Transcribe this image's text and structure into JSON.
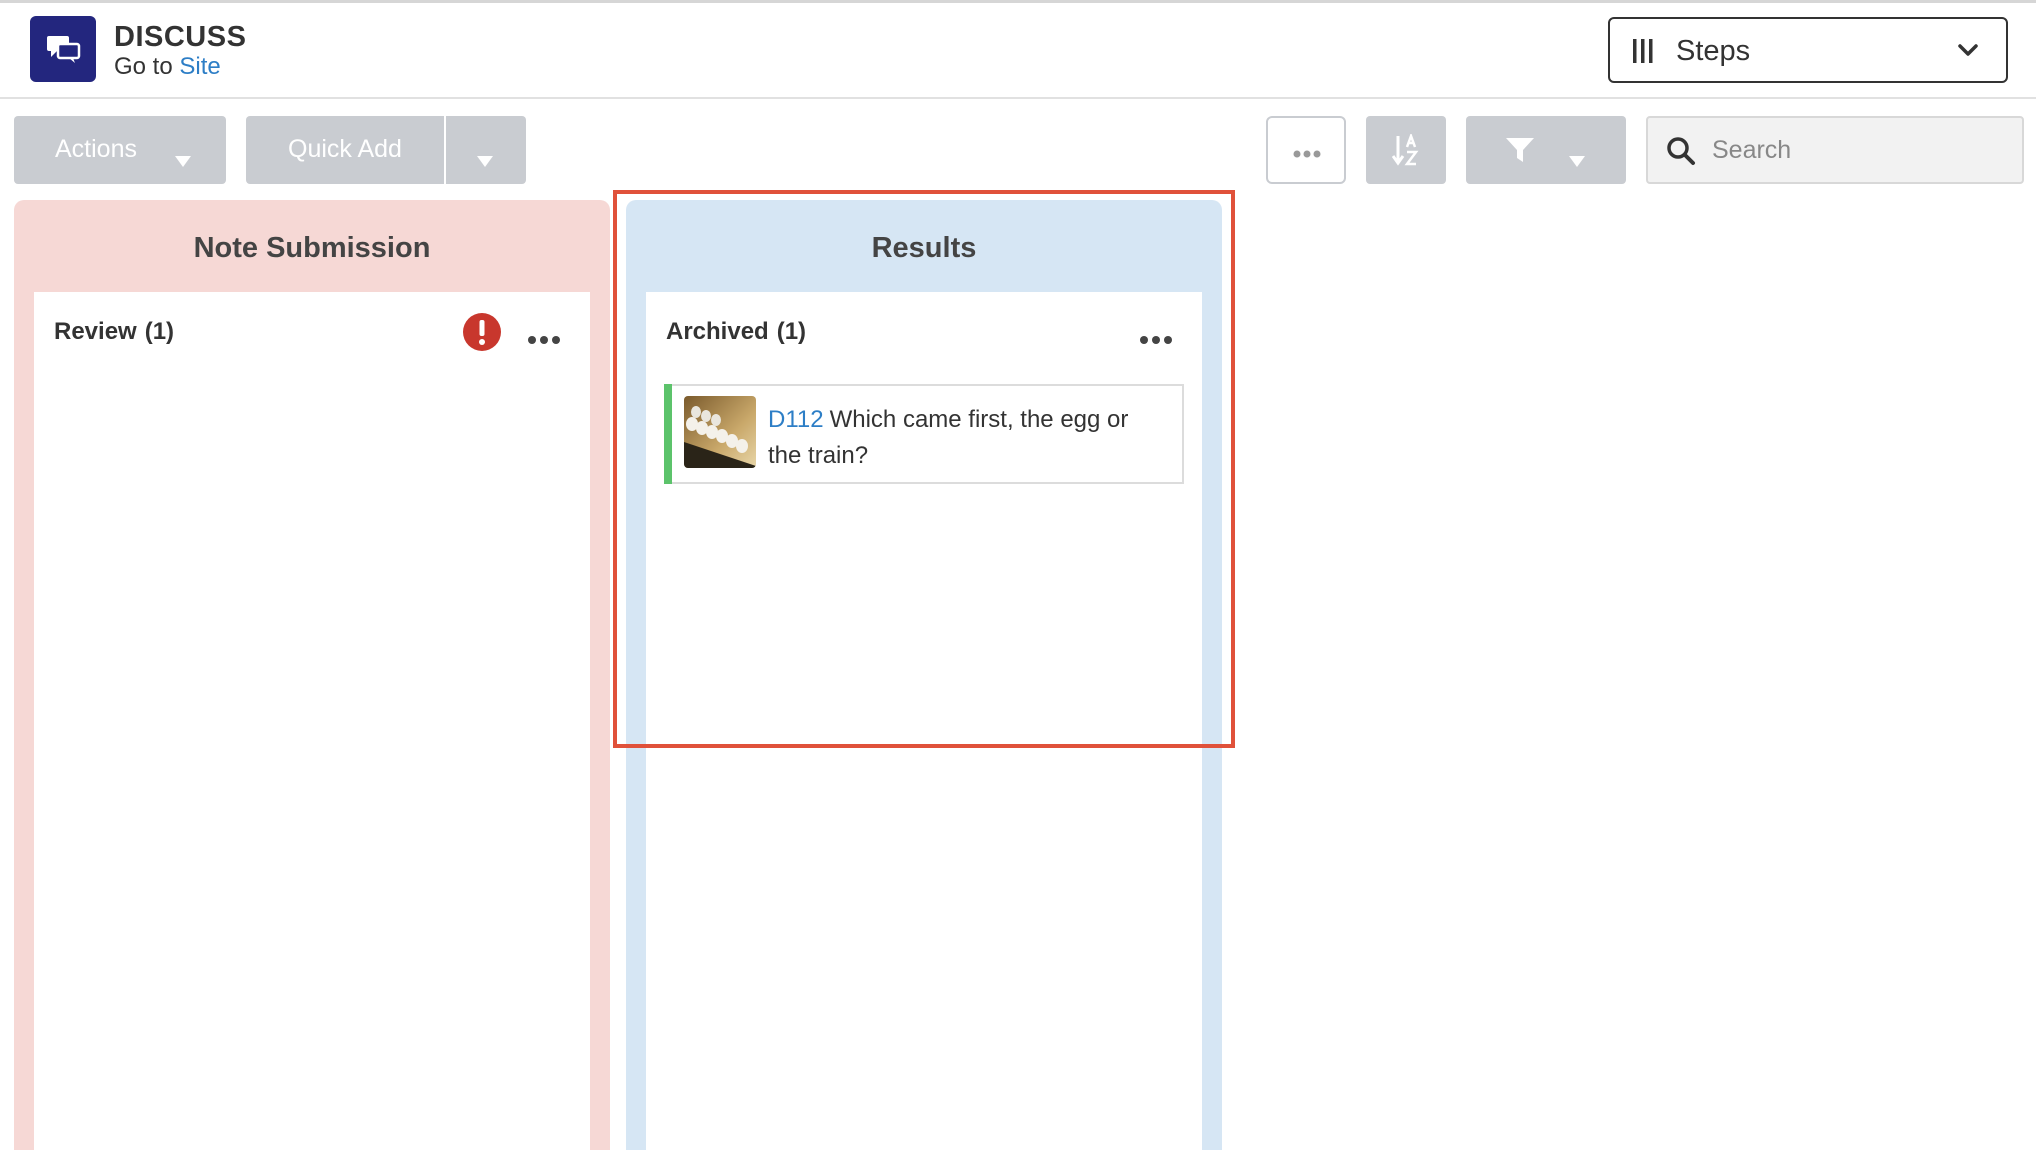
{
  "header": {
    "app_title": "DISCUSS",
    "goto_prefix": "Go to",
    "goto_link": "Site",
    "view_select": {
      "label": "Steps",
      "icon": "columns-icon"
    }
  },
  "toolbar": {
    "actions_label": "Actions",
    "quick_add_label": "Quick Add",
    "search_placeholder": "Search"
  },
  "columns": [
    {
      "title": "Note Submission",
      "color": "#f6d8d5",
      "lanes": [
        {
          "title": "Review",
          "count": "(1)",
          "has_alert": true,
          "cards": []
        }
      ]
    },
    {
      "title": "Results",
      "color": "#d6e6f4",
      "lanes": [
        {
          "title": "Archived",
          "count": "(1)",
          "has_alert": false,
          "cards": [
            {
              "id": "D112",
              "text": "Which came first, the egg or the train?",
              "status_color": "#5cc36b"
            }
          ]
        }
      ]
    }
  ],
  "colors": {
    "app_icon_bg": "#23267e",
    "link": "#2d7ec6",
    "button_bg": "#c9ccd1",
    "alert": "#c8372d",
    "highlight": "#e0513a"
  }
}
